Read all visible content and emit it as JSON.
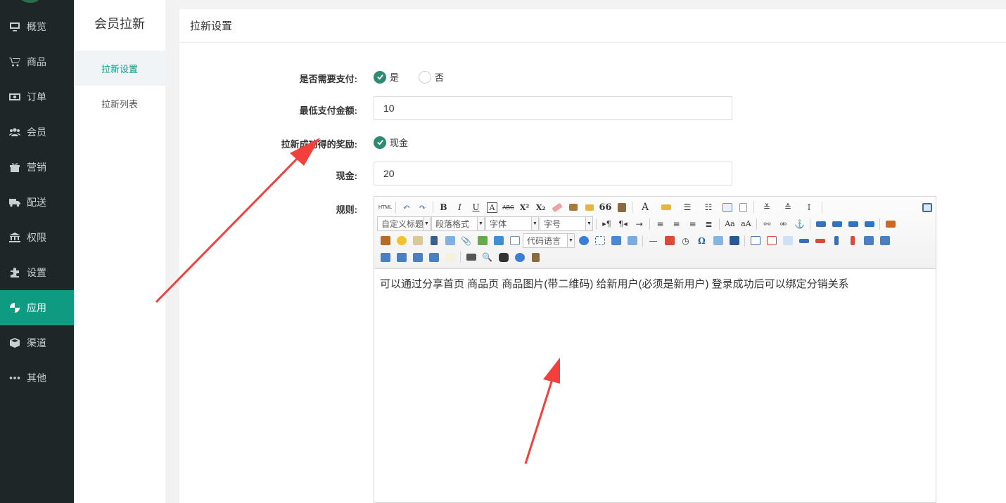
{
  "sidebar": {
    "items": [
      {
        "label": "概览",
        "icon": "monitor-icon"
      },
      {
        "label": "商品",
        "icon": "cart-icon"
      },
      {
        "label": "订单",
        "icon": "money-icon"
      },
      {
        "label": "会员",
        "icon": "users-icon"
      },
      {
        "label": "营销",
        "icon": "gift-icon"
      },
      {
        "label": "配送",
        "icon": "truck-icon"
      },
      {
        "label": "权限",
        "icon": "bank-icon"
      },
      {
        "label": "设置",
        "icon": "puzzle-icon"
      },
      {
        "label": "应用",
        "icon": "apps-icon",
        "active": true
      },
      {
        "label": "渠道",
        "icon": "cube-icon"
      },
      {
        "label": "其他",
        "icon": "more-icon"
      }
    ],
    "active_color": "#0e9b82"
  },
  "submenu": {
    "title": "会员拉新",
    "items": [
      {
        "label": "拉新设置",
        "active": true
      },
      {
        "label": "拉新列表"
      }
    ]
  },
  "panel": {
    "title": "拉新设置",
    "form": {
      "need_pay": {
        "label": "是否需要支付:",
        "options": [
          "是",
          "否"
        ],
        "selected": "是"
      },
      "min_amount": {
        "label": "最低支付金额:",
        "value": "10"
      },
      "reward": {
        "label": "拉新成功得的奖励:",
        "options": [
          "现金"
        ],
        "selected": "现金"
      },
      "cash": {
        "label": "现金:",
        "value": "20"
      },
      "rules": {
        "label": "规则:"
      }
    },
    "editor": {
      "selects": {
        "custom_title": "自定义标题",
        "paragraph": "段落格式",
        "font_family": "字体",
        "font_size": "字号",
        "code_lang": "代码语言"
      },
      "text_buttons": {
        "html": "HTML",
        "bold": "B",
        "italic": "I",
        "underline": "U",
        "border": "A",
        "strike": "ABC",
        "superscript": "X²",
        "subscript": "X₂",
        "quote": "66",
        "font_color": "A",
        "omega": "Ω"
      },
      "content": "可以通过分享首页 商品页 商品图片(带二维码) 给新用户(必须是新用户) 登录成功后可以绑定分销关系"
    }
  },
  "annotation": {
    "arrow_color": "#f2413c"
  }
}
